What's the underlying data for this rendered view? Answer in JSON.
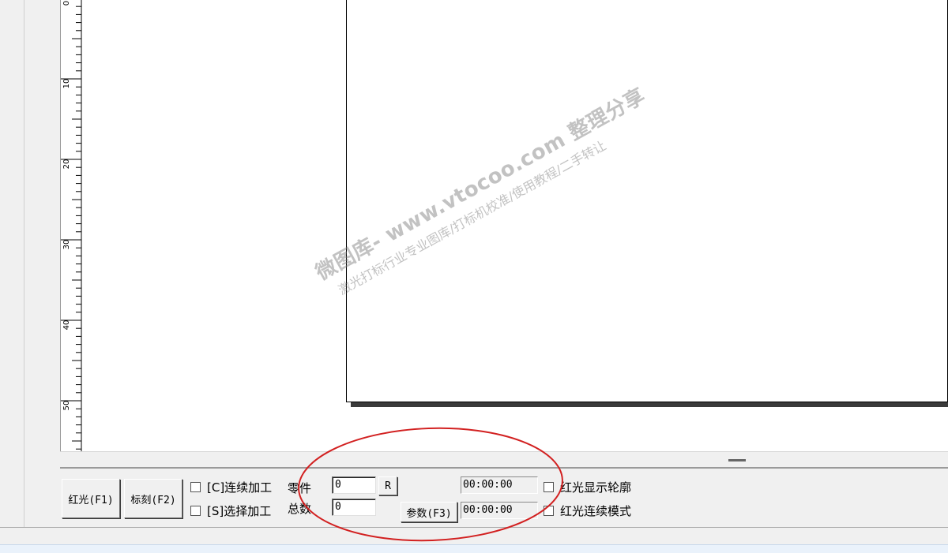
{
  "ruler": {
    "labels": [
      "0",
      "10",
      "20",
      "30",
      "40",
      "50"
    ]
  },
  "controls": {
    "red_light_button": "红光(F1)",
    "mark_button": "标刻(F2)",
    "continuous_label": "[C]连续加工",
    "select_label": "[S]选择加工",
    "part_label": "零件",
    "total_label": "总数",
    "part_value": "0",
    "total_value": "0",
    "reset_button": "R",
    "params_button": "参数(F3)",
    "timer1": "00:00:00",
    "timer2": "00:00:00",
    "contour_label": "红光显示轮廓",
    "continuous_mode_label": "红光连续模式"
  },
  "watermark": {
    "line1": "微图库- www.vtocoo.com 整理分享",
    "line2": "激光打标行业专业图库/打标机校准/使用教程/二手转让"
  },
  "colors": {
    "annotation": "#d22020",
    "window_bg": "#f0f0f0"
  }
}
